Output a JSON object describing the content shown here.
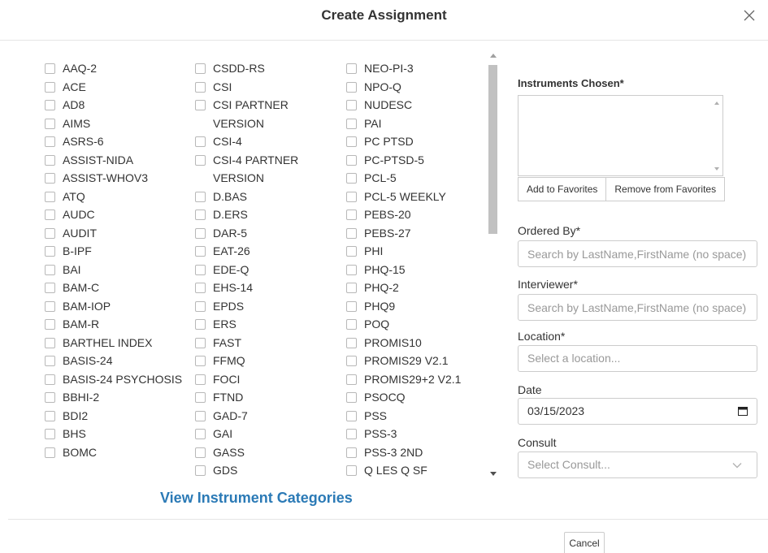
{
  "header": {
    "title": "Create Assignment",
    "close_icon": "close-icon"
  },
  "instruments": {
    "col1": [
      "AAQ-2",
      "ACE",
      "AD8",
      "AIMS",
      "ASRS-6",
      "ASSIST-NIDA",
      "ASSIST-WHOV3",
      "ATQ",
      "AUDC",
      "AUDIT",
      "B-IPF",
      "BAI",
      "BAM-C",
      "BAM-IOP",
      "BAM-R",
      "BARTHEL INDEX",
      "BASIS-24",
      "BASIS-24 PSYCHOSIS",
      "BBHI-2",
      "BDI2",
      "BHS",
      "BOMC"
    ],
    "col2": [
      "CSDD-RS",
      "CSI",
      "CSI PARTNER VERSION",
      "CSI-4",
      "CSI-4 PARTNER VERSION",
      "D.BAS",
      "D.ERS",
      "DAR-5",
      "EAT-26",
      "EDE-Q",
      "EHS-14",
      "EPDS",
      "ERS",
      "FAST",
      "FFMQ",
      "FOCI",
      "FTND",
      "GAD-7",
      "GAI",
      "GASS",
      "GDS"
    ],
    "col3": [
      "NEO-PI-3",
      "NPO-Q",
      "NUDESC",
      "PAI",
      "PC PTSD",
      "PC-PTSD-5",
      "PCL-5",
      "PCL-5 WEEKLY",
      "PEBS-20",
      "PEBS-27",
      "PHI",
      "PHQ-15",
      "PHQ-2",
      "PHQ9",
      "POQ",
      "PROMIS10",
      "PROMIS29 V2.1",
      "PROMIS29+2 V2.1",
      "PSOCQ",
      "PSS",
      "PSS-3",
      "PSS-3 2ND",
      "Q LES Q SF"
    ]
  },
  "view_categories_label": "View Instrument Categories",
  "right_panel": {
    "instruments_chosen_label": "Instruments Chosen*",
    "add_favorites_label": "Add to Favorites",
    "remove_favorites_label": "Remove from Favorites",
    "ordered_by_label": "Ordered By*",
    "ordered_by_placeholder": "Search by LastName,FirstName (no space)",
    "interviewer_label": "Interviewer*",
    "interviewer_placeholder": "Search by LastName,FirstName (no space)",
    "location_label": "Location*",
    "location_placeholder": "Select a location...",
    "date_label": "Date",
    "date_value": "03/15/2023",
    "consult_label": "Consult",
    "consult_placeholder": "Select Consult..."
  },
  "footer": {
    "cancel_label": "Cancel"
  },
  "colors": {
    "link": "#2b7ab6",
    "border": "#cccccc"
  }
}
